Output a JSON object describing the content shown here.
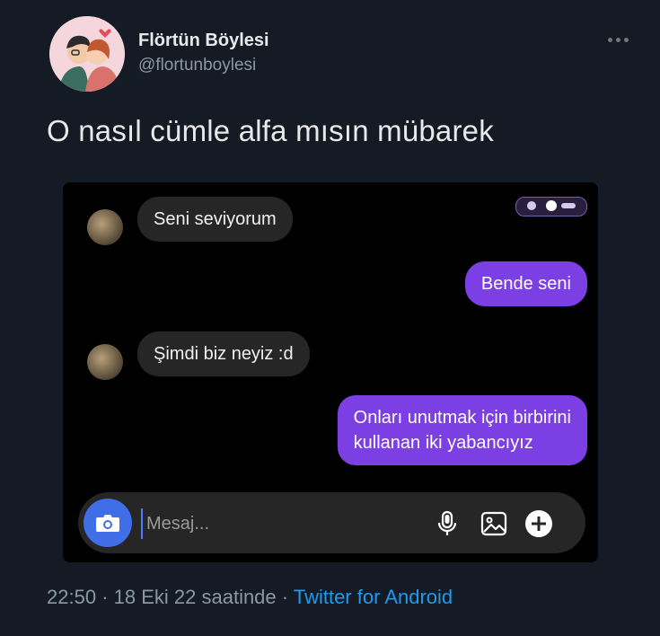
{
  "author": {
    "name": "Flörtün Böylesi",
    "handle": "@flortunboylesi"
  },
  "tweet": {
    "text": "O nasıl cümle alfa mısın mübarek"
  },
  "chat": {
    "messages": [
      {
        "direction": "incoming",
        "text": "Seni seviyorum"
      },
      {
        "direction": "outgoing",
        "text": "Bende seni"
      },
      {
        "direction": "incoming",
        "text": "Şimdi biz neyiz :d"
      },
      {
        "direction": "outgoing",
        "lines": [
          "Onları unutmak için birbirini",
          "kullanan iki yabancıyız"
        ]
      }
    ],
    "composer": {
      "placeholder": "Mesaj..."
    },
    "colors": {
      "outgoing_bubble": "#7b3fe4",
      "incoming_bubble": "#262626",
      "camera_button": "#3f6ee6"
    }
  },
  "footer": {
    "time": "22:50",
    "separator": "·",
    "date": "18 Eki 22 saatinde",
    "source": "Twitter for Android"
  }
}
